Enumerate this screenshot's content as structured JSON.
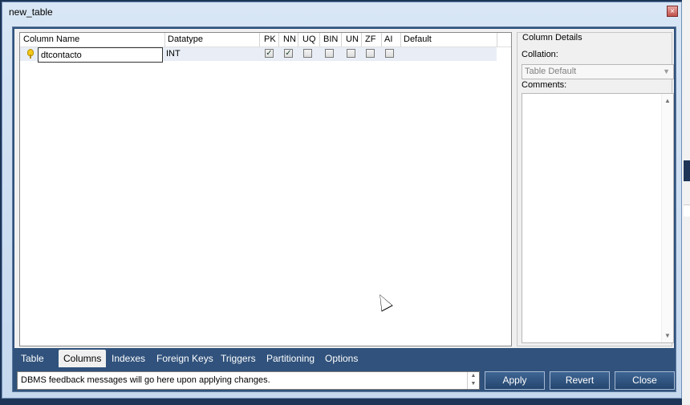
{
  "window": {
    "title": "new_table",
    "close_glyph": "×"
  },
  "grid": {
    "headers": [
      "Column Name",
      "Datatype",
      "PK",
      "NN",
      "UQ",
      "BIN",
      "UN",
      "ZF",
      "AI",
      "Default"
    ],
    "rows": [
      {
        "icon": "key-icon",
        "name": "dtcontacto",
        "datatype": "INT",
        "pk": true,
        "nn": true,
        "uq": false,
        "bin": false,
        "un": false,
        "zf": false,
        "ai": false,
        "default": ""
      }
    ]
  },
  "details": {
    "title": "Column Details",
    "collation_label": "Collation:",
    "collation_value": "Table Default",
    "comments_label": "Comments:",
    "comments_value": ""
  },
  "tabs": [
    "Table",
    "Columns",
    "Indexes",
    "Foreign Keys",
    "Triggers",
    "Partitioning",
    "Options"
  ],
  "active_tab": "Columns",
  "status_message": "DBMS feedback messages will go here upon applying changes.",
  "buttons": {
    "apply": "Apply",
    "revert": "Revert",
    "close": "Close"
  },
  "colors": {
    "accent": "#30527c",
    "row_highlight": "#e9eef6"
  }
}
